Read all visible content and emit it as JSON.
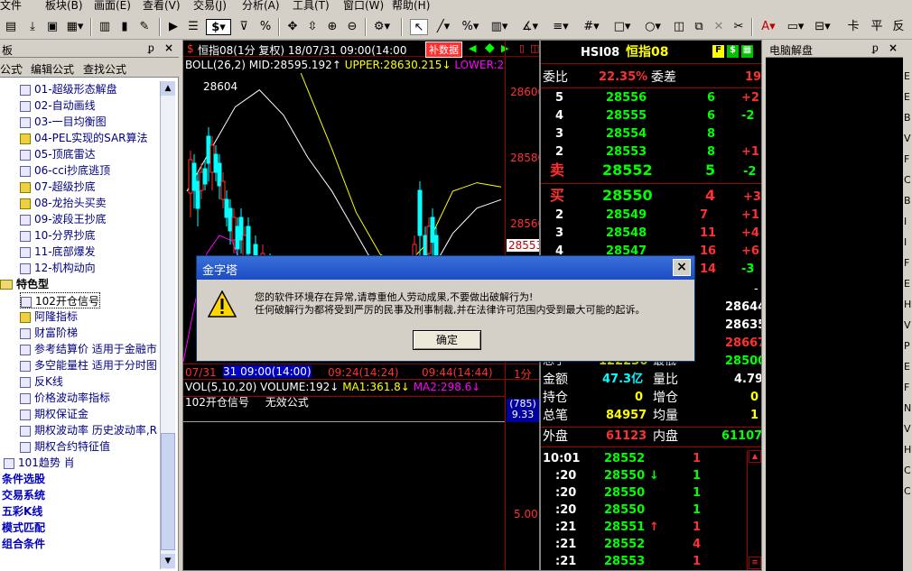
{
  "menu": [
    "文件(F)",
    "板块(B)",
    "画面(E)",
    "查看(V)",
    "交易(J)",
    "分析(A)",
    "工具(T)",
    "窗口(W)",
    "帮助(H)"
  ],
  "menu_lead": "文件",
  "toolbar": {
    "dollar": "$",
    "arrow_down": "▾",
    "text_right": [
      "卡",
      "平",
      "反"
    ]
  },
  "left_panel": {
    "title": "板",
    "tabs": [
      "公式",
      "编辑公式",
      "查找公式"
    ],
    "items": [
      "01-超级形态解盘",
      "02-自动画线",
      "03-一目均衡图",
      "04-PEL实现的SAR算法",
      "05-顶底雷达",
      "06-cci抄底逃顶",
      "07-超级抄底",
      "08-龙抬头买卖",
      "09-波段王抄底",
      "10-分界抄底",
      "11-底部爆发",
      "12-机构动向"
    ],
    "folder": "特色型",
    "special": [
      "102开仓信号",
      "阿隆指标",
      "财富阶梯",
      "参考结算价 适用于金融市",
      "多空能量柱 适用于分时图",
      "反K线",
      "价格波动率指标",
      "期权保证金",
      "期权波动率 历史波动率,R",
      "期权合约特征值"
    ],
    "extra": "101趋势 肖",
    "groups": [
      "条件选股",
      "交易系统",
      "五彩K线",
      "模式匹配",
      "组合条件"
    ]
  },
  "chart": {
    "title": "恒指08(1分 复权) 18/07/31 09:00(14:00",
    "title_button": "补数据",
    "boll": "BOLL(26,2)",
    "mid": "MID:28595.192↑",
    "upper": "UPPER:28630.215↓",
    "lower": "LOWER:2",
    "high_label": "28604",
    "y_ticks": [
      "28600",
      "28580",
      "28560"
    ],
    "last_price": "28553",
    "time_axis": [
      "07/31",
      "31 09:00(14:00)",
      "09:24(14:24)",
      "09:44(14:44)",
      "1分"
    ],
    "vol_line": "VOL(5,10,20) VOLUME:192↓",
    "ma1": "MA1:361.8↓",
    "ma2": "MA2:298.6↓",
    "indicator": "102开仓信号",
    "indicator_status": "无效公式",
    "side_vals": [
      "(785)",
      "9.33"
    ],
    "bottom_tick": "5.00",
    "chart_data": {
      "type": "line",
      "title": "恒指08(1分 复权)",
      "xlabel": "",
      "ylabel": "",
      "ylim": [
        28540,
        28608
      ],
      "ticks": [
        28600,
        28580,
        28560
      ],
      "series": [
        {
          "name": "BOLL",
          "values": [
            28640,
            28642,
            28638,
            28628,
            28618,
            28604,
            28590,
            28575,
            28565,
            28562,
            28568,
            28580,
            28582,
            28581
          ]
        },
        {
          "name": "MID",
          "values": [
            28580,
            28590,
            28600,
            28604,
            28598,
            28588,
            28580,
            28570,
            28560,
            28556,
            28560,
            28570,
            28576,
            28578
          ]
        }
      ]
    }
  },
  "quote": {
    "code": "HSI08",
    "name": "恒指08",
    "btn": [
      "F",
      "$"
    ],
    "weibi_label": "委比",
    "weibi_value": "22.35%",
    "weicha_label": "委差",
    "weicha_value": "19",
    "asks": [
      {
        "lvl": "5",
        "p": "28556",
        "v": "6",
        "d": "+2"
      },
      {
        "lvl": "4",
        "p": "28555",
        "v": "6",
        "d": "-2"
      },
      {
        "lvl": "3",
        "p": "28554",
        "v": "8",
        "d": ""
      },
      {
        "lvl": "2",
        "p": "28553",
        "v": "8",
        "d": "+1"
      }
    ],
    "sell1": {
      "lvl": "卖",
      "p": "28552",
      "v": "5",
      "d": "-2"
    },
    "buy1": {
      "lvl": "买",
      "p": "28550",
      "v": "4",
      "d": "+3"
    },
    "bids": [
      {
        "lvl": "2",
        "p": "28549",
        "v": "7",
        "d": "+1"
      },
      {
        "lvl": "3",
        "p": "28548",
        "v": "11",
        "d": "+4"
      },
      {
        "lvl": "4",
        "p": "28547",
        "v": "16",
        "d": "+6"
      },
      {
        "lvl": "5",
        "p": "",
        "v": "14",
        "d": "-3"
      }
    ],
    "dash": "-",
    "stats": [
      "28644",
      "28635",
      "28667",
      "28500"
    ],
    "amount_label": "金额",
    "amount": "47.3亿",
    "lb_label": "量比",
    "lb": "4.79",
    "oi_label": "持仓",
    "oi": "0",
    "zc_label": "增仓",
    "zc": "0",
    "total_label": "总笔",
    "total": "84957",
    "avg_label": "均量",
    "avg": "1",
    "partial_label": "总手",
    "partial": "122236",
    "partial2": "最低",
    "outer_label": "外盘",
    "outer": "61123",
    "inner_label": "内盘",
    "inner": "61107",
    "ticks": [
      {
        "t": "10:01",
        "p": "28552",
        "arrow": "",
        "v": "1",
        "vc": "r"
      },
      {
        "t": ":20",
        "p": "28550",
        "arrow": "↓",
        "v": "1",
        "vc": "g"
      },
      {
        "t": ":20",
        "p": "28550",
        "arrow": "",
        "v": "1",
        "vc": "g"
      },
      {
        "t": ":20",
        "p": "28550",
        "arrow": "",
        "v": "1",
        "vc": "g"
      },
      {
        "t": ":21",
        "p": "28551",
        "arrow": "↑",
        "v": "1",
        "vc": "r"
      },
      {
        "t": ":21",
        "p": "28552",
        "arrow": "",
        "v": "4",
        "vc": "r"
      },
      {
        "t": ":21",
        "p": "28553",
        "arrow": "",
        "v": "1",
        "vc": "r"
      }
    ]
  },
  "far_panel": {
    "title": "电脑解盘",
    "letters": [
      "E",
      "E",
      "B",
      "V",
      "F",
      "C",
      "B",
      "I",
      "I",
      "F",
      "E",
      "H",
      "V",
      "P",
      "E",
      "F",
      "N",
      "V",
      "H",
      "C",
      "C"
    ]
  },
  "dialog": {
    "title": "金字塔",
    "line1": "您的软件环境存在异常,请尊重他人劳动成果,不要做出破解行为!",
    "line2": "任何破解行为都将受到严厉的民事及刑事制裁,并在法律许可范围内受到最大可能的起诉。",
    "ok": "确定"
  },
  "colors": {
    "up": "#ff3030",
    "down": "#00ff00",
    "boll": "#ffff00",
    "mid": "#ffffff",
    "lower": "#ff00ff",
    "bg": "#000000"
  }
}
